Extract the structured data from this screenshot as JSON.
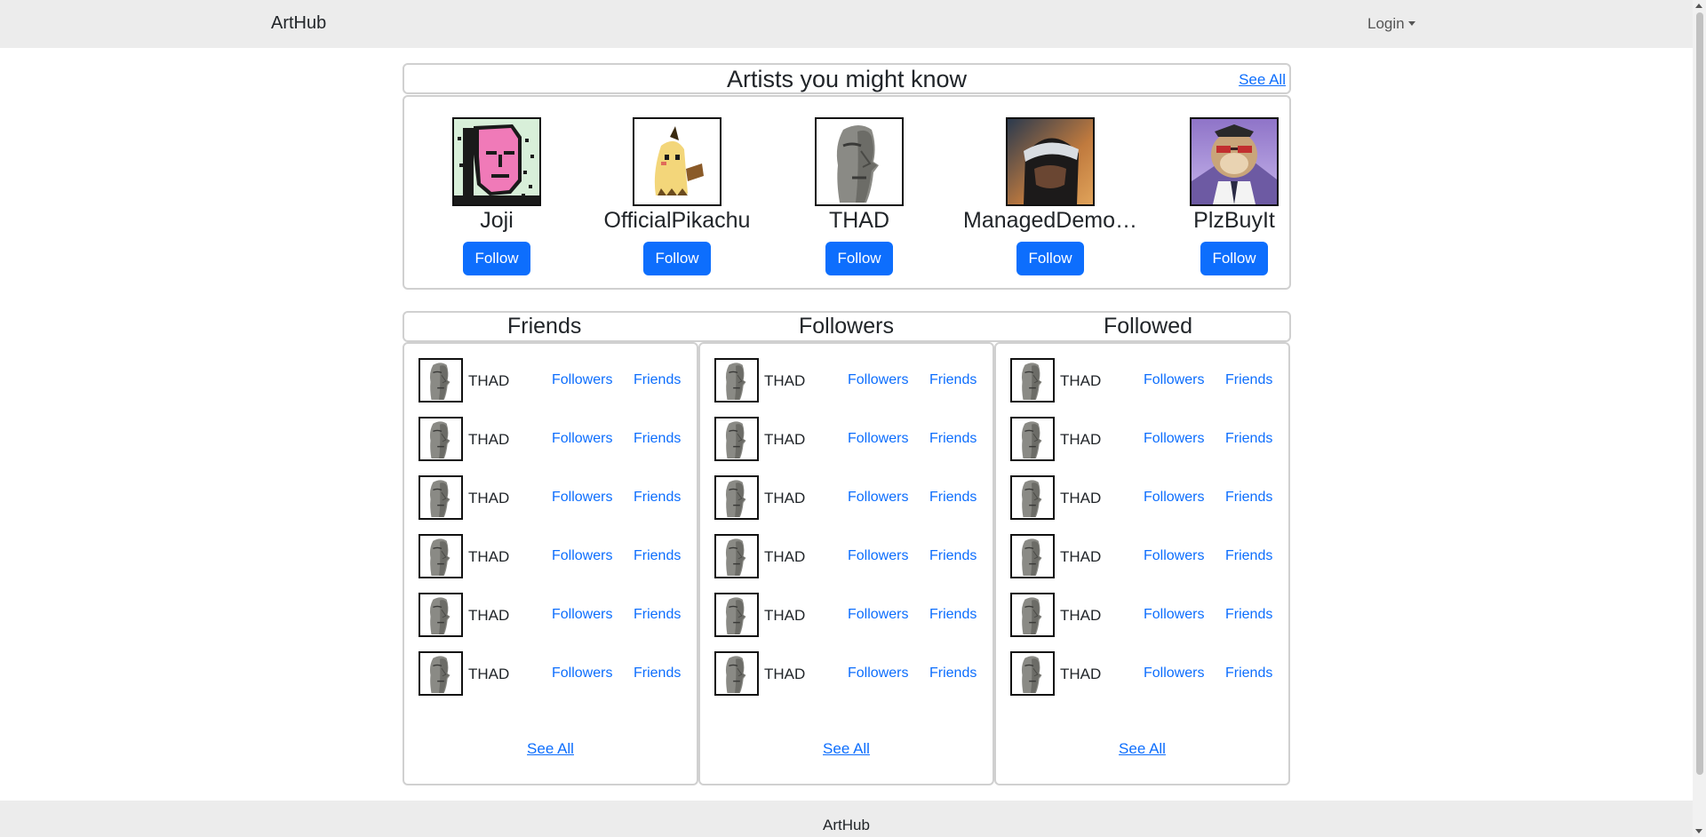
{
  "navbar": {
    "brand": "ArtHub",
    "login_label": "Login"
  },
  "artists": {
    "title": "Artists you might know",
    "see_all": "See All",
    "items": [
      {
        "name": "Joji",
        "follow_label": "Follow",
        "avatar": "pink-pixel-face-avatar"
      },
      {
        "name": "OfficialPikachu",
        "follow_label": "Follow",
        "avatar": "mimikyu-pixel-avatar"
      },
      {
        "name": "THAD",
        "follow_label": "Follow",
        "avatar": "moai-head-avatar"
      },
      {
        "name": "ManagedDemo…",
        "follow_label": "Follow",
        "avatar": "ninja-headband-avatar"
      },
      {
        "name": "PlzBuyIt",
        "follow_label": "Follow",
        "avatar": "ape-nft-avatar"
      }
    ]
  },
  "columns": [
    {
      "title": "Friends",
      "see_all": "See All",
      "rows": [
        {
          "name": "THAD",
          "followers_label": "Followers",
          "friends_label": "Friends"
        },
        {
          "name": "THAD",
          "followers_label": "Followers",
          "friends_label": "Friends"
        },
        {
          "name": "THAD",
          "followers_label": "Followers",
          "friends_label": "Friends"
        },
        {
          "name": "THAD",
          "followers_label": "Followers",
          "friends_label": "Friends"
        },
        {
          "name": "THAD",
          "followers_label": "Followers",
          "friends_label": "Friends"
        },
        {
          "name": "THAD",
          "followers_label": "Followers",
          "friends_label": "Friends"
        }
      ]
    },
    {
      "title": "Followers",
      "see_all": "See All",
      "rows": [
        {
          "name": "THAD",
          "followers_label": "Followers",
          "friends_label": "Friends"
        },
        {
          "name": "THAD",
          "followers_label": "Followers",
          "friends_label": "Friends"
        },
        {
          "name": "THAD",
          "followers_label": "Followers",
          "friends_label": "Friends"
        },
        {
          "name": "THAD",
          "followers_label": "Followers",
          "friends_label": "Friends"
        },
        {
          "name": "THAD",
          "followers_label": "Followers",
          "friends_label": "Friends"
        },
        {
          "name": "THAD",
          "followers_label": "Followers",
          "friends_label": "Friends"
        }
      ]
    },
    {
      "title": "Followed",
      "see_all": "See All",
      "rows": [
        {
          "name": "THAD",
          "followers_label": "Followers",
          "friends_label": "Friends"
        },
        {
          "name": "THAD",
          "followers_label": "Followers",
          "friends_label": "Friends"
        },
        {
          "name": "THAD",
          "followers_label": "Followers",
          "friends_label": "Friends"
        },
        {
          "name": "THAD",
          "followers_label": "Followers",
          "friends_label": "Friends"
        },
        {
          "name": "THAD",
          "followers_label": "Followers",
          "friends_label": "Friends"
        },
        {
          "name": "THAD",
          "followers_label": "Followers",
          "friends_label": "Friends"
        }
      ]
    }
  ],
  "footer": {
    "text": "ArtHub"
  },
  "colors": {
    "accent": "#0d6efd",
    "navbar_bg": "#ececec",
    "border": "#d0d0d0"
  }
}
